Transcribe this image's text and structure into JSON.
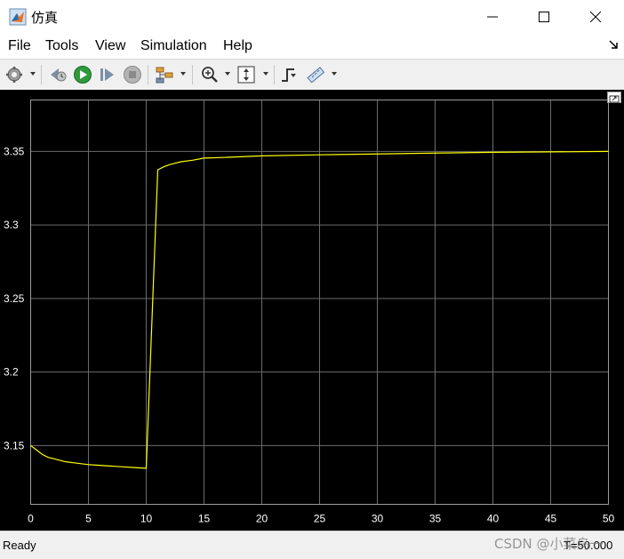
{
  "window": {
    "title": "仿真",
    "app_icon": "matlab-icon",
    "controls": [
      "minimize-icon",
      "maximize-icon",
      "close-icon"
    ]
  },
  "menu": {
    "items": [
      "File",
      "Tools",
      "View",
      "Simulation",
      "Help"
    ]
  },
  "toolbar": {
    "icons": [
      "settings-icon",
      "step-back-icon",
      "run-icon",
      "step-forward-icon",
      "stop-icon",
      "signal-hierarchy-icon",
      "zoom-icon",
      "autoscale-icon",
      "triggers-icon",
      "measurements-icon"
    ]
  },
  "status": {
    "text": "Ready",
    "time": "T=50.000",
    "watermark": "CSDN @小菜鸟一"
  },
  "colors": {
    "plot_background": "#000000",
    "grid": "#6b6b6b",
    "axis_text": "#ffffff",
    "signal": "#ffff00"
  },
  "chart_data": {
    "type": "line",
    "title": "",
    "xlabel": "",
    "ylabel": "",
    "xlim": [
      0,
      50
    ],
    "ylim": [
      3.11,
      3.385
    ],
    "grid": true,
    "xticks": [
      "0",
      "5",
      "10",
      "15",
      "20",
      "25",
      "30",
      "35",
      "40",
      "45",
      "50"
    ],
    "yticks": [
      "3.15",
      "3.2",
      "3.25",
      "3.3",
      "3.35"
    ],
    "series": [
      {
        "x": [
          0,
          0.5,
          1,
          1.5,
          2,
          3,
          4,
          5,
          6,
          7,
          8,
          9,
          10,
          11,
          11.5,
          12,
          12.5,
          13,
          14,
          15,
          17,
          20,
          25,
          30,
          35,
          40,
          45,
          50
        ],
        "y": [
          3.15,
          3.147,
          3.144,
          3.142,
          3.141,
          3.139,
          3.138,
          3.137,
          3.1365,
          3.136,
          3.1355,
          3.135,
          3.1345,
          3.3375,
          3.3395,
          3.341,
          3.342,
          3.343,
          3.344,
          3.3455,
          3.346,
          3.347,
          3.3477,
          3.3483,
          3.3489,
          3.3494,
          3.3497,
          3.35
        ]
      }
    ]
  }
}
